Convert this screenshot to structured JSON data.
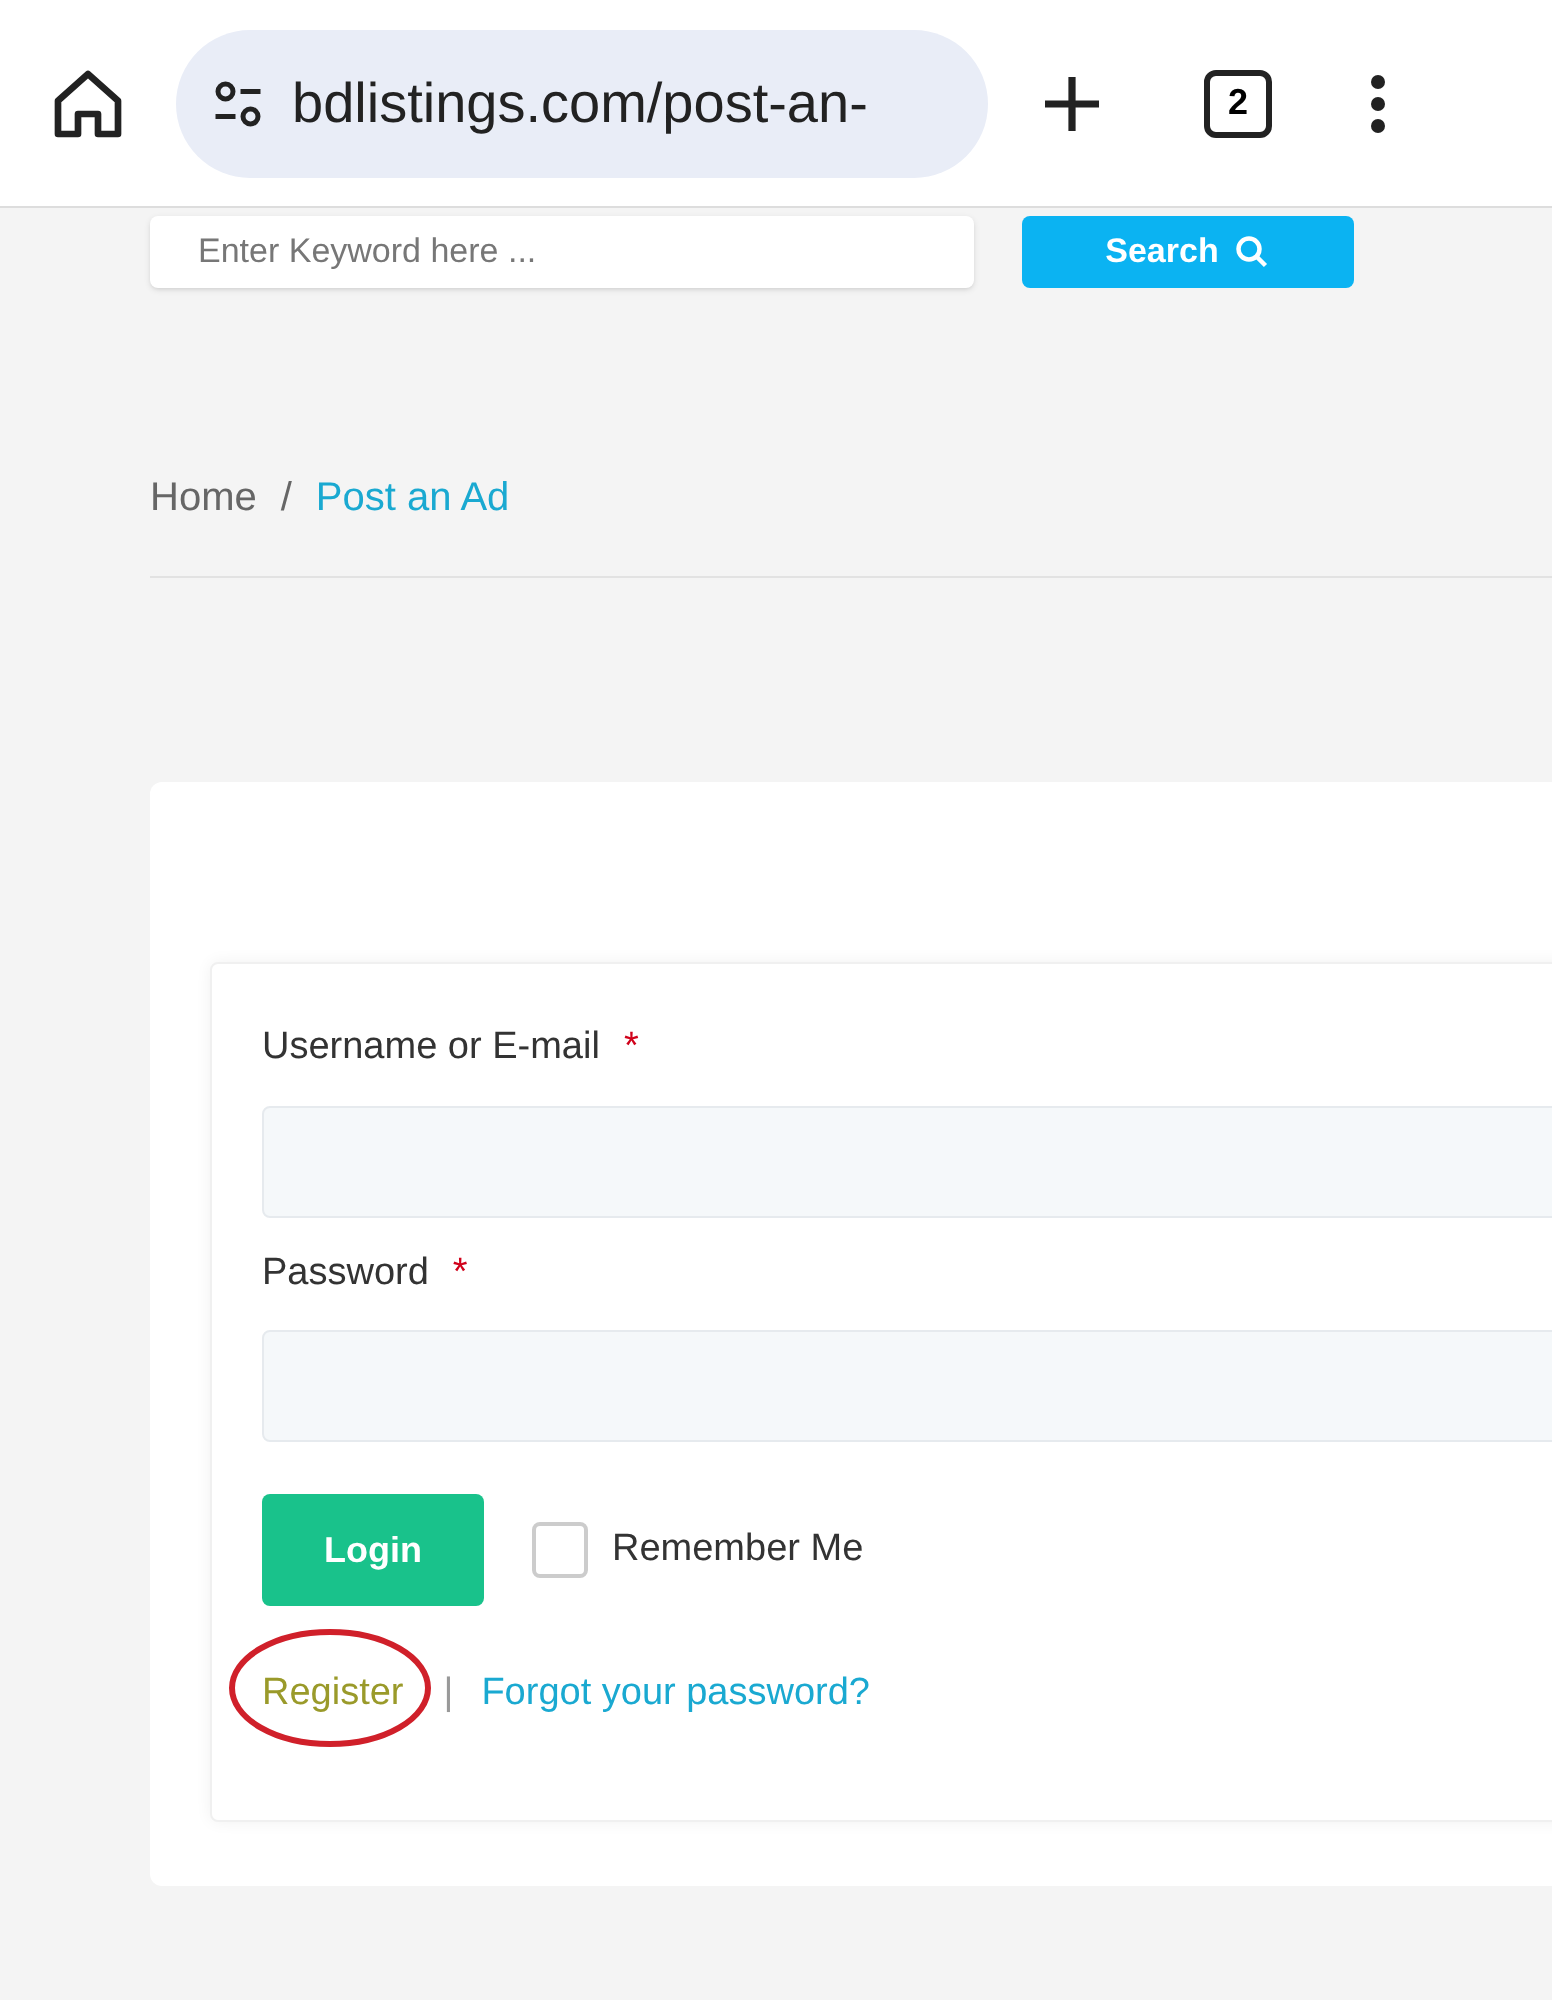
{
  "browser": {
    "url": "bdlistings.com/post-an-",
    "tab_count": "2"
  },
  "search": {
    "placeholder": "Enter Keyword here ...",
    "button": "Search"
  },
  "breadcrumb": [
    {
      "label": "Home",
      "current": false
    },
    {
      "separator": "/",
      "label": "Post an Ad",
      "current": true
    }
  ],
  "login_form": {
    "fields": [
      {
        "label": "Username or E-mail",
        "required": "*"
      },
      {
        "label": "Password",
        "required": "*"
      }
    ],
    "login_button": "Login",
    "remember_me": {
      "label": "Remember Me",
      "checked": false
    },
    "register_link": "Register",
    "register_circled": true,
    "separator": "|",
    "forgot_link": "Forgot your password?"
  }
}
